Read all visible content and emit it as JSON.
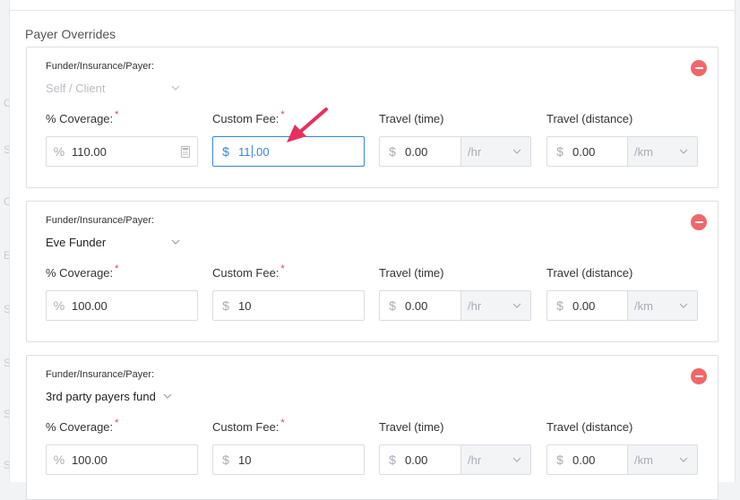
{
  "section_title": "Payer Overrides",
  "background_letters": [
    "C",
    "S",
    "C",
    "E",
    "S",
    "S",
    "S",
    "S",
    "S"
  ],
  "labels": {
    "funder": "Funder/Insurance/Payer:",
    "coverage": "% Coverage:",
    "custom_fee": "Custom Fee:",
    "travel_time": "Travel (time)",
    "travel_distance": "Travel (distance)",
    "required_mark": "*"
  },
  "symbols": {
    "percent": "%",
    "dollar": "$"
  },
  "units": {
    "time": "/hr",
    "distance": "/km"
  },
  "overrides": [
    {
      "funder": "Self / Client",
      "funder_disabled": true,
      "coverage": "110.00",
      "custom_fee_before_caret": "11",
      "custom_fee_after_caret": ".00",
      "travel_time": "0.00",
      "travel_distance": "0.00"
    },
    {
      "funder": "Eve Funder",
      "funder_disabled": false,
      "coverage": "100.00",
      "custom_fee": "10",
      "travel_time": "0.00",
      "travel_distance": "0.00"
    },
    {
      "funder": "3rd party payers fund",
      "funder_disabled": false,
      "coverage": "100.00",
      "custom_fee": "10",
      "travel_time": "0.00",
      "travel_distance": "0.00"
    }
  ],
  "colors": {
    "accent": "#3a84d6",
    "danger": "#f0676b",
    "annotation_arrow": "#e8305f"
  }
}
